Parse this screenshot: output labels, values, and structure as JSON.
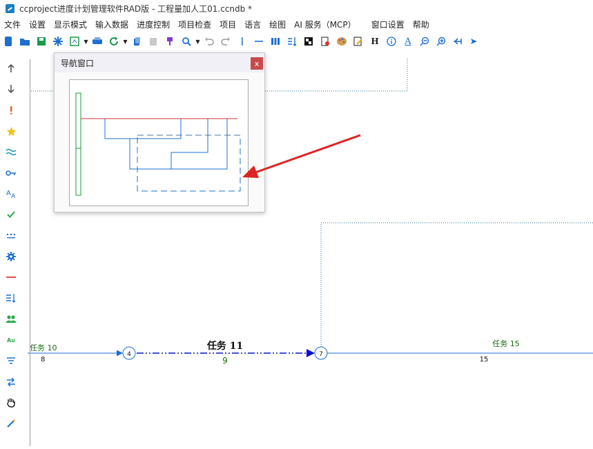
{
  "window": {
    "title": "ccproject进度计划管理软件RAD版 - 工程量加人工01.ccndb *"
  },
  "menu": [
    "文件",
    "设置",
    "显示模式",
    "输入数据",
    "进度控制",
    "项目检查",
    "项目",
    "语言",
    "绘图",
    "AI 服务（MCP）",
    "窗口设置",
    "帮助"
  ],
  "toolbar": {
    "icons": [
      "new-icon",
      "open-icon",
      "save-icon",
      "star-burst-icon",
      "export-icon",
      "print-icon",
      "refresh-icon",
      "copy-icon",
      "paste-icon",
      "brush-icon",
      "zoom-icon",
      "undo-icon",
      "redo-icon",
      "vertical-line-icon",
      "horizontal-line-icon",
      "columns-icon",
      "sort-icon",
      "contrast-icon",
      "delete-doc-icon",
      "palette-icon",
      "edit-icon",
      "heading-icon",
      "info-icon",
      "font-icon",
      "zoom-out-icon",
      "zoom-in-icon",
      "arrow-collapse-icon",
      "arrow-expand-icon"
    ],
    "heading_glyph": "H",
    "font_glyph": "A"
  },
  "sidebar": {
    "icons": [
      "arrow-up-icon",
      "arrow-down-icon",
      "exclamation-icon",
      "star-icon",
      "wave-icon",
      "key-icon",
      "font-size-icon",
      "check-icon",
      "dots-icon",
      "gear-icon",
      "minus-red-icon",
      "sort-lines-icon",
      "users-icon",
      "text-au-icon",
      "filter-lines-icon",
      "swap-icon",
      "hand-icon",
      "magic-wand-icon"
    ],
    "au_glyph": "Au"
  },
  "nav_window": {
    "title": "导航窗口",
    "close_glyph": "x"
  },
  "diagram": {
    "nodes": [
      {
        "id": "4",
        "label": "4"
      },
      {
        "id": "7",
        "label": "7"
      }
    ],
    "tasks": [
      {
        "name": "任务 10",
        "duration": "8"
      },
      {
        "name": "任务 11",
        "duration": "9"
      },
      {
        "name": "任务 15",
        "duration": "15"
      }
    ]
  },
  "colors": {
    "link": "#1c6fd1",
    "critical": "#0a10c8",
    "label_green": "#1a6a10",
    "arrow_red": "#dd2424"
  }
}
